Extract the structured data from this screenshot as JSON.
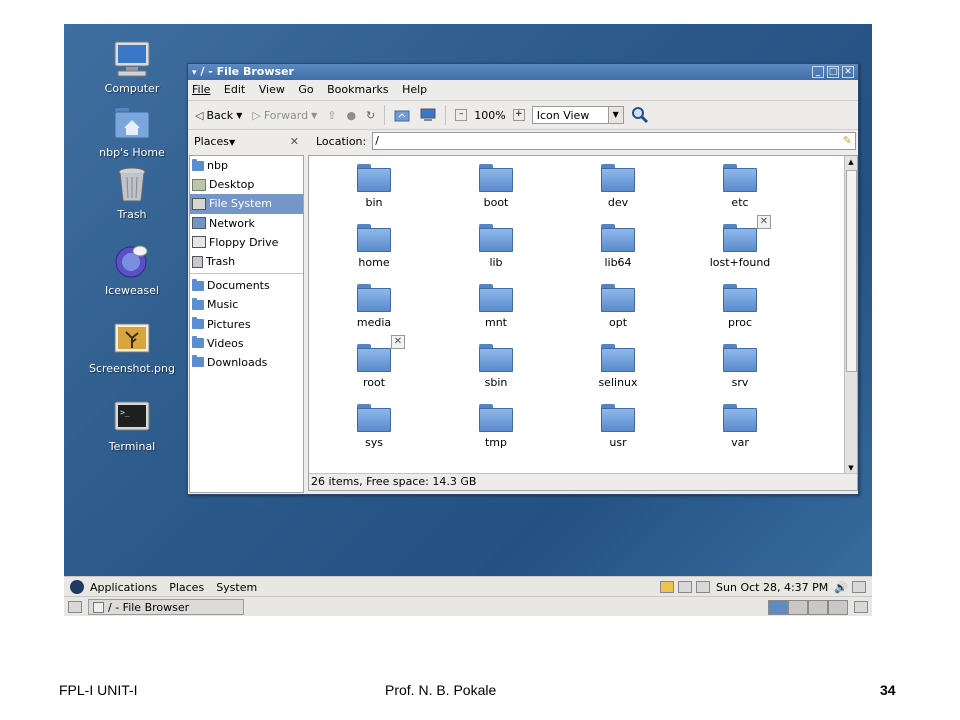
{
  "desktop": {
    "icons": [
      {
        "label": "Computer",
        "icon": "computer-icon"
      },
      {
        "label": "nbp's Home",
        "icon": "home-folder-icon"
      },
      {
        "label": "Trash",
        "icon": "trash-icon"
      },
      {
        "label": "Iceweasel",
        "icon": "iceweasel-icon"
      },
      {
        "label": "Screenshot.png",
        "icon": "image-file-icon"
      },
      {
        "label": "Terminal",
        "icon": "terminal-icon"
      }
    ]
  },
  "window": {
    "title": "/ - File Browser",
    "menu": [
      "File",
      "Edit",
      "View",
      "Go",
      "Bookmarks",
      "Help"
    ],
    "toolbar": {
      "back": "Back",
      "forward": "Forward",
      "zoom": "100%",
      "view": "Icon View"
    },
    "sidebar": {
      "header": "Places",
      "items": [
        {
          "label": "nbp",
          "icon": "home-icon"
        },
        {
          "label": "Desktop",
          "icon": "desktop-icon"
        },
        {
          "label": "File System",
          "icon": "filesystem-icon"
        },
        {
          "label": "Network",
          "icon": "network-icon"
        },
        {
          "label": "Floppy Drive",
          "icon": "floppy-icon"
        },
        {
          "label": "Trash",
          "icon": "trash-icon"
        }
      ],
      "bookmarks": [
        {
          "label": "Documents",
          "icon": "folder-icon"
        },
        {
          "label": "Music",
          "icon": "folder-icon"
        },
        {
          "label": "Pictures",
          "icon": "folder-icon"
        },
        {
          "label": "Videos",
          "icon": "folder-icon"
        },
        {
          "label": "Downloads",
          "icon": "folder-icon"
        }
      ]
    },
    "location": {
      "label": "Location:",
      "value": "/"
    },
    "files": [
      {
        "name": "bin"
      },
      {
        "name": "boot"
      },
      {
        "name": "dev"
      },
      {
        "name": "etc"
      },
      {
        "name": "home"
      },
      {
        "name": "lib"
      },
      {
        "name": "lib64"
      },
      {
        "name": "lost+found",
        "locked": true
      },
      {
        "name": "media"
      },
      {
        "name": "mnt"
      },
      {
        "name": "opt"
      },
      {
        "name": "proc"
      },
      {
        "name": "root",
        "locked": true
      },
      {
        "name": "sbin"
      },
      {
        "name": "selinux"
      },
      {
        "name": "srv"
      },
      {
        "name": "sys"
      },
      {
        "name": "tmp"
      },
      {
        "name": "usr"
      },
      {
        "name": "var"
      }
    ],
    "status": "26 items, Free space: 14.3 GB"
  },
  "top_panel": {
    "menus": [
      "Applications",
      "Places",
      "System"
    ],
    "clock": "Sun Oct 28,  4:37 PM"
  },
  "bottom_panel": {
    "task": "/ - File Browser"
  },
  "footer": {
    "left": "FPL-I  UNIT-I",
    "center": "Prof. N. B. Pokale",
    "page": "34"
  },
  "colors": {
    "desktop": "#2c5a8a",
    "folder": "#6a9ad6",
    "selection": "#7596c9",
    "titlebar": "#4a78b2"
  }
}
